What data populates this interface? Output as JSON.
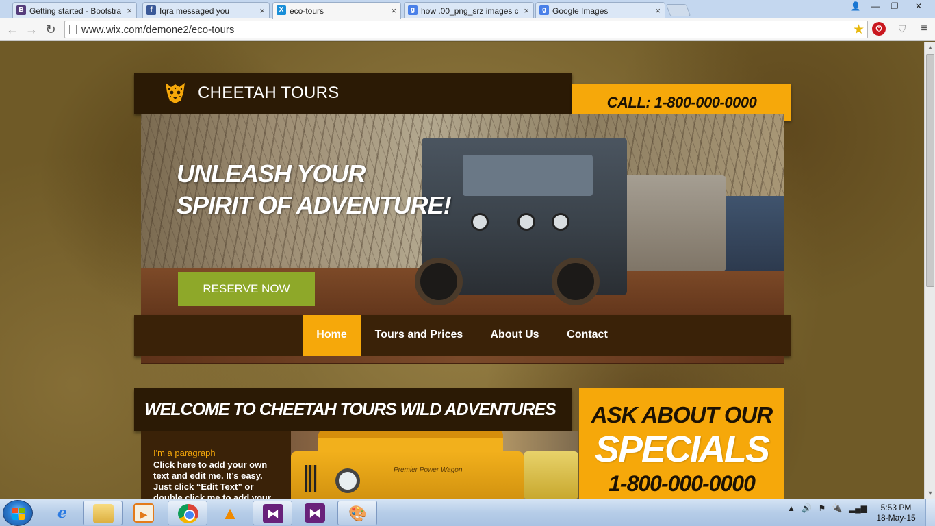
{
  "browser": {
    "tabs": [
      {
        "label": "Getting started · Bootstrap",
        "favicon": "B",
        "favicon_color": "#563d7c",
        "active": false
      },
      {
        "label": "Iqra messaged you",
        "favicon": "f",
        "favicon_color": "#3b5998",
        "active": false
      },
      {
        "label": "eco-tours",
        "favicon": "X",
        "favicon_color": "#1a8fd8",
        "active": true
      },
      {
        "label": "how .00_png_srz images c",
        "favicon": "g",
        "favicon_color": "#4a80e8",
        "active": false
      },
      {
        "label": "Google Images",
        "favicon": "g",
        "favicon_color": "#4a80e8",
        "active": false
      }
    ],
    "tab_close_glyph": "×",
    "url": "www.wix.com/demone2/eco-tours",
    "window_controls": {
      "user": "👤",
      "minimize": "—",
      "maximize": "❐",
      "close": "✕"
    },
    "nav_glyphs": {
      "back": "←",
      "forward": "→",
      "reload": "↻",
      "star": "★",
      "menu": "≡",
      "stop_ext": "⏻",
      "shield_ext": "⛉"
    }
  },
  "site": {
    "logo_text": "CHEETAH TOURS",
    "call": "CALL: 1-800-000-0000",
    "hero": {
      "headline_line1": "UNLEASH YOUR",
      "headline_line2": "SPIRIT OF ADVENTURE!",
      "cta": "RESERVE NOW"
    },
    "nav": [
      {
        "label": "Home",
        "active": true
      },
      {
        "label": "Tours and Prices",
        "active": false
      },
      {
        "label": "About Us",
        "active": false
      },
      {
        "label": "Contact",
        "active": false
      }
    ],
    "welcome": "WELCOME TO CHEETAH TOURS WILD ADVENTURES",
    "paragraph_title": "I'm a paragraph",
    "paragraph_body": "Click here to add your own text and edit me. It’s easy. Just click “Edit Text” or double click me to add your",
    "jeep_brand": "Premier Power Wagon",
    "specials": {
      "line1": "ASK ABOUT OUR",
      "line2": "SPECIALS",
      "line3": "1-800-000-0000"
    },
    "colors": {
      "accent": "#f6a80a",
      "dark": "#2b1a05",
      "cta": "#8ea829"
    }
  },
  "taskbar": {
    "apps": [
      {
        "name": "internet-explorer",
        "glyph": "e",
        "running": false
      },
      {
        "name": "windows-explorer",
        "glyph": "",
        "running": true
      },
      {
        "name": "media-player",
        "glyph": "▶",
        "running": false
      },
      {
        "name": "chrome",
        "glyph": "",
        "running": true
      },
      {
        "name": "vlc",
        "glyph": "▲",
        "running": false
      },
      {
        "name": "visual-studio",
        "glyph": "⧓",
        "running": true
      },
      {
        "name": "visual-studio-2",
        "glyph": "⧓",
        "running": false
      },
      {
        "name": "paint",
        "glyph": "🎨",
        "running": true
      }
    ],
    "tray_glyphs": {
      "arrow": "▲",
      "volume": "🔊",
      "flag": "⚑",
      "power": "🔌",
      "signal": "▂▄▆"
    },
    "time": "5:53 PM",
    "date": "18-May-15"
  }
}
